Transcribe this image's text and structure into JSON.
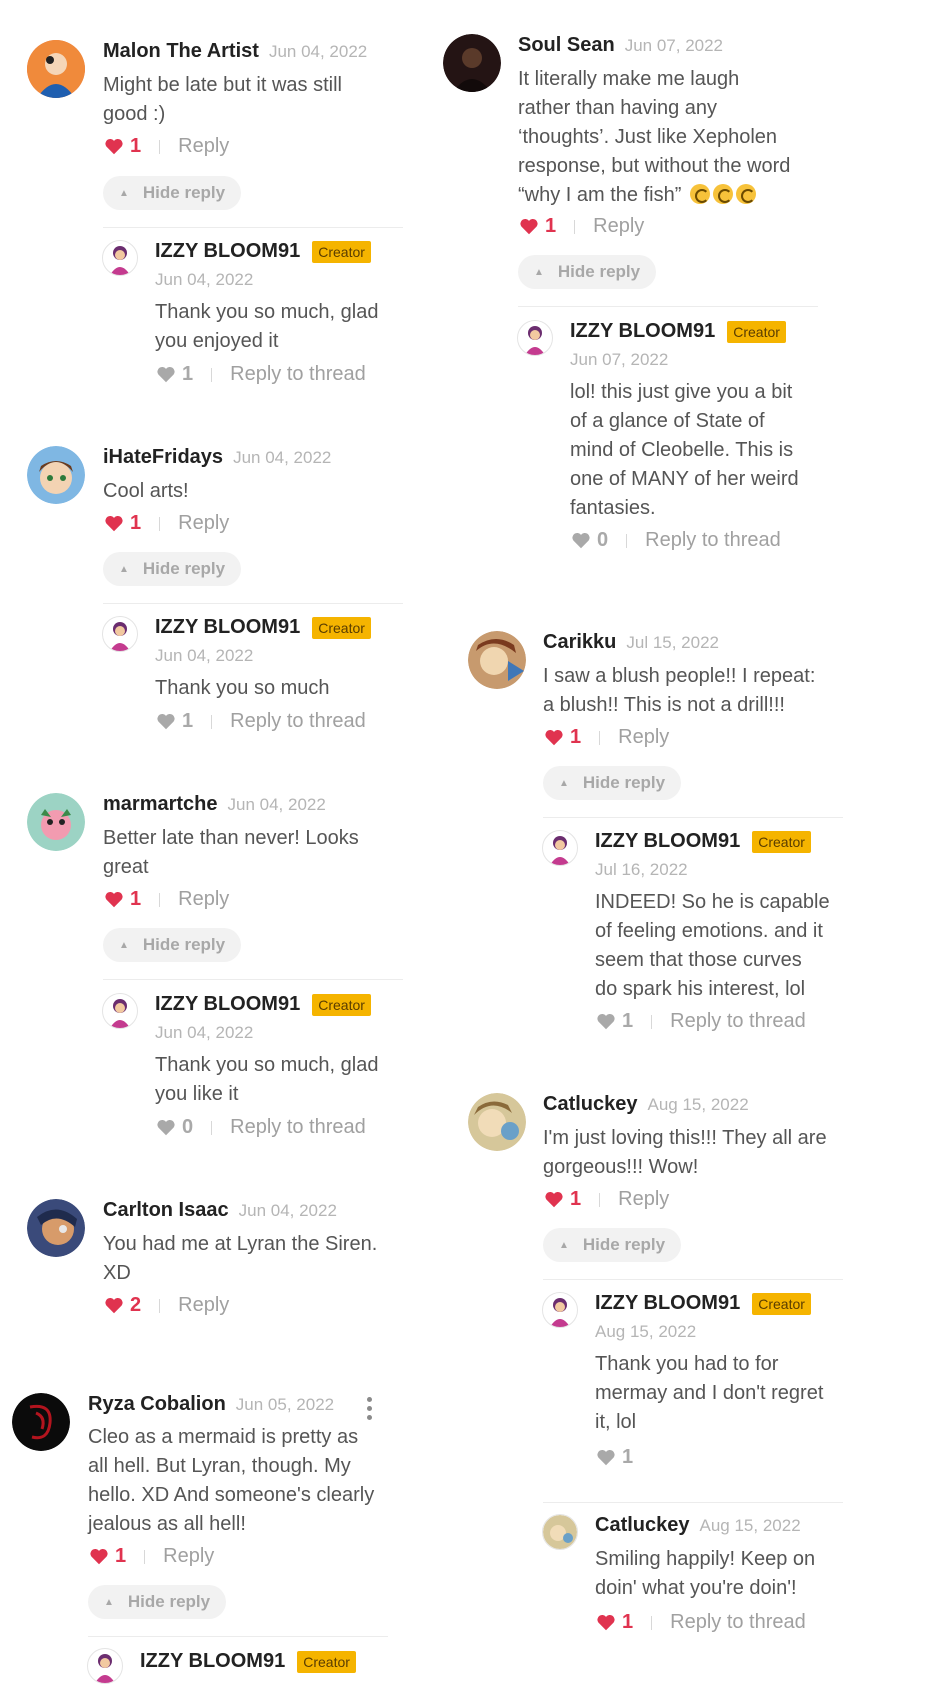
{
  "creator_badge": "Creator",
  "reply_label": "Reply",
  "reply_thread_label": "Reply to thread",
  "hide_reply_label": "Hide reply",
  "c1": {
    "name": "Malon The Artist",
    "date": "Jun 04, 2022",
    "lines": [
      "Might be late but it was still",
      "good :)"
    ],
    "likes": "1"
  },
  "c1r": {
    "name": "IZZY BLOOM91",
    "date": "Jun 04, 2022",
    "lines": [
      "Thank you so much, glad",
      "you enjoyed it"
    ],
    "likes": "1"
  },
  "c2": {
    "name": "iHateFridays",
    "date": "Jun 04, 2022",
    "lines": [
      "Cool arts!"
    ],
    "likes": "1"
  },
  "c2r": {
    "name": "IZZY BLOOM91",
    "date": "Jun 04, 2022",
    "lines": [
      "Thank you so much"
    ],
    "likes": "1"
  },
  "c3": {
    "name": "marmartche",
    "date": "Jun 04, 2022",
    "lines": [
      "Better late than never! Looks",
      "great"
    ],
    "likes": "1"
  },
  "c3r": {
    "name": "IZZY BLOOM91",
    "date": "Jun 04, 2022",
    "lines": [
      "Thank you so much, glad",
      "you like it"
    ],
    "likes": "0"
  },
  "c4": {
    "name": "Carlton Isaac",
    "date": "Jun 04, 2022",
    "lines": [
      "You had me at Lyran the Siren.",
      "XD"
    ],
    "likes": "2"
  },
  "c5": {
    "name": "Ryza Cobalion",
    "date": "Jun 05, 2022",
    "lines": [
      "Cleo as a mermaid is pretty as",
      "all hell. But Lyran, though. My",
      "hello. XD And someone's clearly",
      "jealous as all hell!"
    ],
    "likes": "1"
  },
  "c5r": {
    "name": "IZZY BLOOM91"
  },
  "c6": {
    "name": "Soul Sean",
    "date": "Jun 07, 2022",
    "lines": [
      "It literally make me laugh",
      "rather than having any",
      "‘thoughts’. Just like Xepholen",
      "response, but without the word",
      "“why I am the fish”"
    ],
    "likes": "1"
  },
  "c6r": {
    "name": "IZZY BLOOM91",
    "date": "Jun 07, 2022",
    "lines": [
      "lol! this just give you a bit",
      "of a glance of State of",
      "mind of Cleobelle. This is",
      "one of MANY of her weird",
      "fantasies."
    ],
    "likes": "0"
  },
  "c7": {
    "name": "Carikku",
    "date": "Jul 15, 2022",
    "lines": [
      "I saw a blush people!! I repeat:",
      "a blush!! This is not a drill!!!"
    ],
    "likes": "1"
  },
  "c7r": {
    "name": "IZZY BLOOM91",
    "date": "Jul 16, 2022",
    "lines": [
      "INDEED! So he is capable",
      "of feeling emotions. and it",
      "seem that those curves",
      "do spark his interest, lol"
    ],
    "likes": "1"
  },
  "c8": {
    "name": "Catluckey",
    "date": "Aug 15, 2022",
    "lines": [
      "I'm just loving this!!! They all are",
      "gorgeous!!! Wow!"
    ],
    "likes": "1"
  },
  "c8r": {
    "name": "IZZY BLOOM91",
    "date": "Aug 15, 2022",
    "lines": [
      "Thank you had to for",
      "mermay and I don't regret",
      "it, lol"
    ],
    "likes": "1"
  },
  "c8r2": {
    "name": "Catluckey",
    "date": "Aug 15, 2022",
    "lines": [
      "Smiling happily! Keep on",
      "doin' what you're doin'!"
    ],
    "likes": "1"
  },
  "colors": {
    "accent_red": "#e0334f",
    "badge": "#f5b400",
    "grey_heart": "#a9a9a9"
  }
}
